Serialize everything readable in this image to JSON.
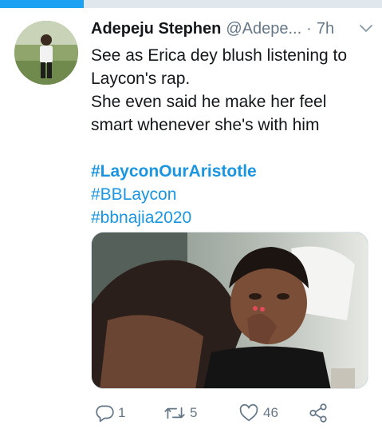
{
  "progress": 0.22,
  "tweet": {
    "author_name": "Adepeju Stephen",
    "author_handle": "@Adepe...",
    "separator": "·",
    "time": "7h",
    "text_lines": [
      "See as Erica dey blush listening to",
      "Laycon's rap.",
      "She even said he make her feel",
      "smart whenever she's with him"
    ],
    "hashtags": [
      "#LayconOurAristotle",
      "#BBLaycon",
      "#bbnajia2020"
    ]
  },
  "actions": {
    "reply_count": "1",
    "retweet_count": "5",
    "like_count": "46"
  },
  "icons": {
    "menu": "chevron-down-icon",
    "reply": "reply-icon",
    "retweet": "retweet-icon",
    "like": "heart-icon",
    "share": "share-icon"
  },
  "colors": {
    "accent": "#1da1f2",
    "hashtag": "#1b95e0",
    "secondary_text": "#657786",
    "primary_text": "#14171a"
  }
}
